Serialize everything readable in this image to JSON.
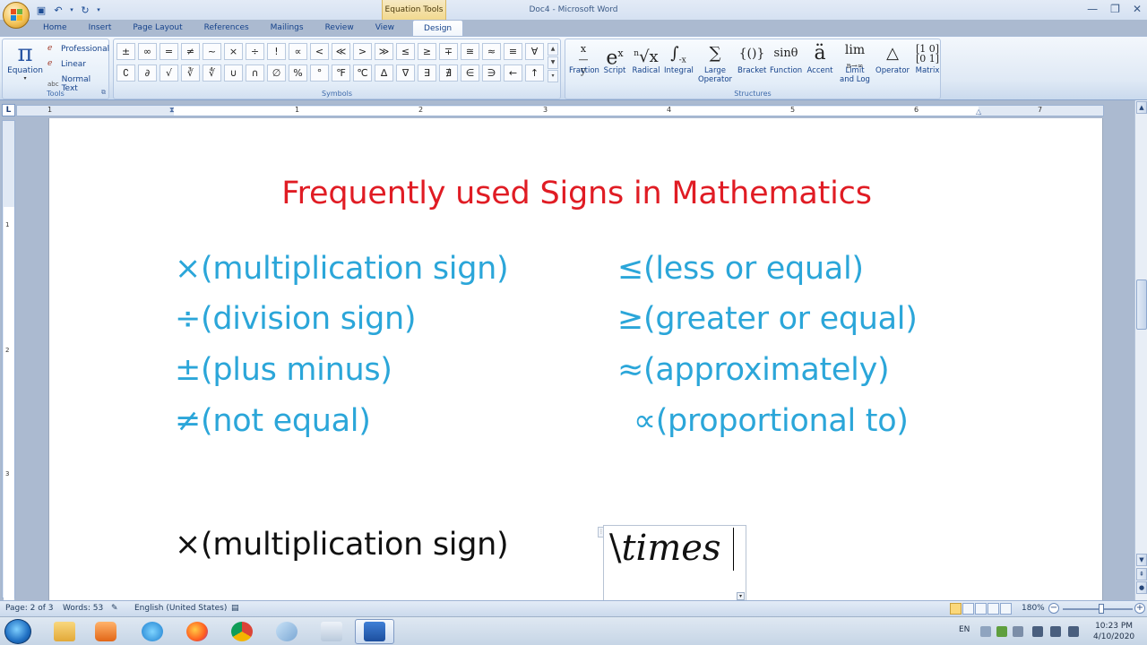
{
  "window": {
    "title": "Doc4 - Microsoft Word",
    "contextual_tab_group": "Equation Tools",
    "controls": [
      "—",
      "❐",
      "✕"
    ]
  },
  "tabs": [
    {
      "label": "Home",
      "active": false
    },
    {
      "label": "Insert",
      "active": false
    },
    {
      "label": "Page Layout",
      "active": false
    },
    {
      "label": "References",
      "active": false
    },
    {
      "label": "Mailings",
      "active": false
    },
    {
      "label": "Review",
      "active": false
    },
    {
      "label": "View",
      "active": false
    },
    {
      "label": "Design",
      "active": true
    }
  ],
  "tools_group": {
    "label": "Tools",
    "equation_label": "Equation",
    "professional_label": "Professional",
    "linear_label": "Linear",
    "normal_text_label": "Normal Text",
    "normal_text_icon": "abc"
  },
  "symbols_group": {
    "label": "Symbols",
    "symbols": [
      "±",
      "∞",
      "=",
      "≠",
      "~",
      "×",
      "÷",
      "!",
      "∝",
      "<",
      "≪",
      ">",
      "≫",
      "≤",
      "≥",
      "∓",
      "≅",
      "≈",
      "≡",
      "∀",
      "∁",
      "∂",
      "√",
      "∛",
      "∜",
      "∪",
      "∩",
      "∅",
      "%",
      "°",
      "℉",
      "℃",
      "∆",
      "∇",
      "∃",
      "∄",
      "∈",
      "∋",
      "←",
      "↑"
    ]
  },
  "structures_group": {
    "label": "Structures",
    "items": [
      {
        "icon": "x/y",
        "label": "Fraction"
      },
      {
        "icon": "eˣ",
        "label": "Script"
      },
      {
        "icon": "ⁿ√x",
        "label": "Radical"
      },
      {
        "icon": "∫",
        "label": "Integral"
      },
      {
        "icon": "∑",
        "label": "Large Operator"
      },
      {
        "icon": "{()}",
        "label": "Bracket"
      },
      {
        "icon": "sinθ",
        "label": "Function"
      },
      {
        "icon": "ä",
        "label": "Accent"
      },
      {
        "icon": "lim",
        "label": "Limit and Log"
      },
      {
        "icon": "△",
        "label": "Operator"
      },
      {
        "icon": "[1 0; 0 1]",
        "label": "Matrix"
      }
    ]
  },
  "ruler": {
    "h_numbers": [
      "1",
      "1",
      "2",
      "3",
      "4",
      "5",
      "6",
      "7"
    ],
    "v_numbers": [
      "1",
      "2",
      "3"
    ]
  },
  "document": {
    "title": "Frequently used Signs in Mathematics",
    "left_column": [
      "×(multiplication sign)",
      "÷(division sign)",
      "±(plus minus)",
      "≠(not equal)"
    ],
    "right_column": [
      "≤(less or equal)",
      "≥(greater or equal)",
      "≈(approximately)",
      "∝(proportional to)"
    ],
    "example_text": "×(multiplication sign)",
    "equation_backslash": "\\",
    "equation_word": "times"
  },
  "statusbar": {
    "page": "Page: 2 of 3",
    "words": "Words: 53",
    "language": "English (United States)",
    "zoom": "180%"
  },
  "taskbar": {
    "tray_language": "EN",
    "time": "10:23 PM",
    "date": "4/10/2020"
  },
  "colors": {
    "title_red": "#e01c24",
    "sign_blue": "#2ba6d9",
    "ribbon_blue": "#15428b"
  }
}
